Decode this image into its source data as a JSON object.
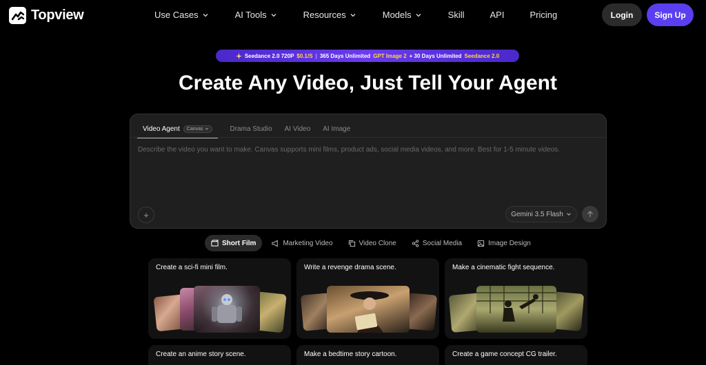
{
  "brand": {
    "name": "Topview"
  },
  "nav": {
    "items": [
      {
        "label": "Use Cases",
        "has_dropdown": true
      },
      {
        "label": "AI Tools",
        "has_dropdown": true
      },
      {
        "label": "Resources",
        "has_dropdown": true
      },
      {
        "label": "Models",
        "has_dropdown": true
      },
      {
        "label": "Skill",
        "has_dropdown": false
      },
      {
        "label": "API",
        "has_dropdown": false
      },
      {
        "label": "Pricing",
        "has_dropdown": false
      }
    ],
    "login_label": "Login",
    "signup_label": "Sign Up"
  },
  "promo": {
    "part1": "Seedance 2.0 720P",
    "part2": "$0.1/S",
    "sep": "|",
    "part3": "365 Days Unlimited",
    "part4": "GPT Image 2",
    "part5": "+ 30 Days Unlimited",
    "part6": "Seedance 2.0"
  },
  "hero": {
    "title": "Create Any Video, Just Tell Your Agent"
  },
  "composer": {
    "tabs": [
      {
        "label": "Video Agent",
        "badge": "Canvas",
        "active": true
      },
      {
        "label": "Drama Studio",
        "active": false
      },
      {
        "label": "AI Video",
        "active": false
      },
      {
        "label": "AI Image",
        "active": false
      }
    ],
    "placeholder": "Describe the video you want to make. Canvas supports mini films, product ads, social media videos, and more. Best for 1-5 minute videos.",
    "add_label": "+",
    "model": "Gemini 3.5 Flash"
  },
  "categories": [
    {
      "label": "Short Film",
      "icon": "film-icon",
      "active": true
    },
    {
      "label": "Marketing Video",
      "icon": "megaphone-icon",
      "active": false
    },
    {
      "label": "Video Clone",
      "icon": "copy-icon",
      "active": false
    },
    {
      "label": "Social Media",
      "icon": "share-icon",
      "active": false
    },
    {
      "label": "Image Design",
      "icon": "image-icon",
      "active": false
    }
  ],
  "cards": [
    {
      "title": "Create a sci-fi mini film."
    },
    {
      "title": "Write a revenge drama scene."
    },
    {
      "title": "Make a cinematic fight sequence."
    },
    {
      "title": "Create an anime story scene."
    },
    {
      "title": "Make a bedtime story cartoon."
    },
    {
      "title": "Create a game concept CG trailer."
    }
  ],
  "colors": {
    "accent": "#5a3ff0",
    "promo_highlight": "#ffd84a",
    "background": "#000000"
  }
}
